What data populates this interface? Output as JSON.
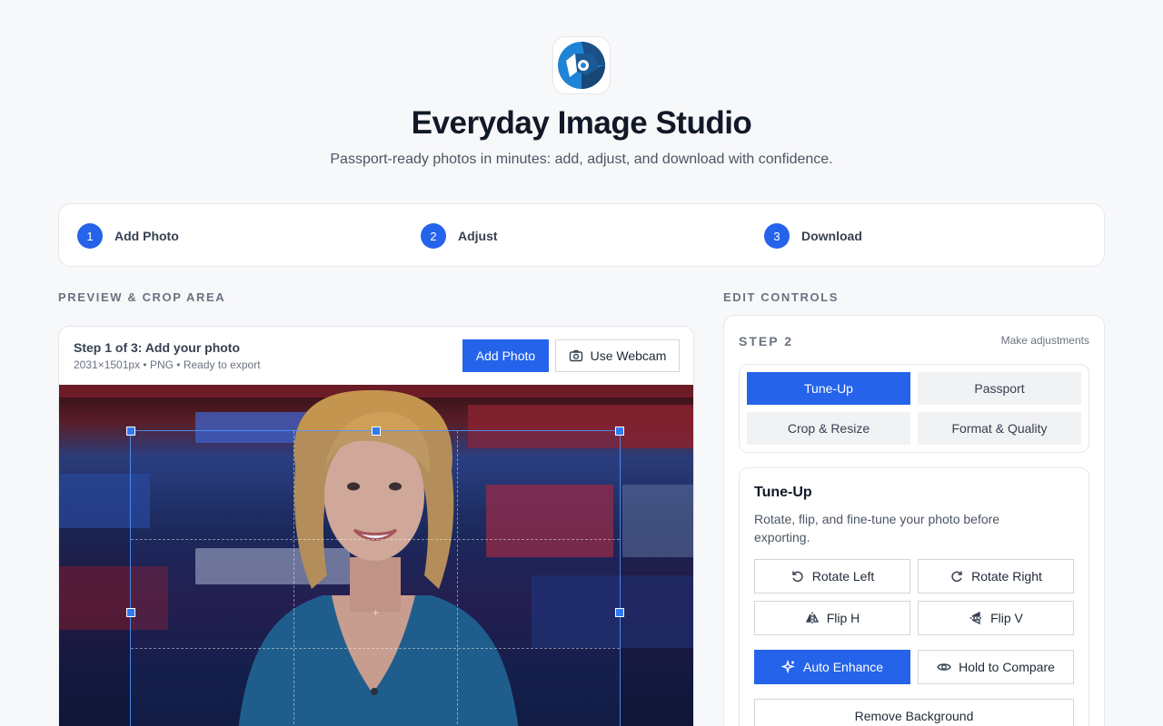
{
  "app": {
    "title": "Everyday Image Studio",
    "tagline": "Passport-ready photos in minutes: add, adjust, and download with confidence.",
    "logo_icon": "camera-aperture-icon"
  },
  "stepper": [
    {
      "num": "1",
      "label": "Add Photo"
    },
    {
      "num": "2",
      "label": "Adjust"
    },
    {
      "num": "3",
      "label": "Download"
    }
  ],
  "preview": {
    "section_title": "PREVIEW & CROP AREA",
    "step_title": "Step 1 of 3: Add your photo",
    "meta": "2031×1501px • PNG • Ready to export",
    "add_photo_label": "Add Photo",
    "webcam_label": "Use Webcam",
    "webcam_icon": "camera-icon"
  },
  "controls": {
    "section_title": "EDIT CONTROLS",
    "step_label": "STEP 2",
    "step_note": "Make adjustments",
    "tabs": [
      {
        "label": "Tune-Up",
        "active": true
      },
      {
        "label": "Passport",
        "active": false
      },
      {
        "label": "Crop & Resize",
        "active": false
      },
      {
        "label": "Format & Quality",
        "active": false
      }
    ],
    "tune": {
      "title": "Tune-Up",
      "description": "Rotate, flip, and fine-tune your photo before exporting.",
      "rotate_left": "Rotate Left",
      "rotate_right": "Rotate Right",
      "flip_h": "Flip H",
      "flip_v": "Flip V",
      "auto_enhance": "Auto Enhance",
      "hold_compare": "Hold to Compare",
      "remove_background": "Remove Background"
    }
  },
  "colors": {
    "accent": "#2563eb",
    "page_bg": "#f7f8fa",
    "border": "#e5e7eb"
  }
}
